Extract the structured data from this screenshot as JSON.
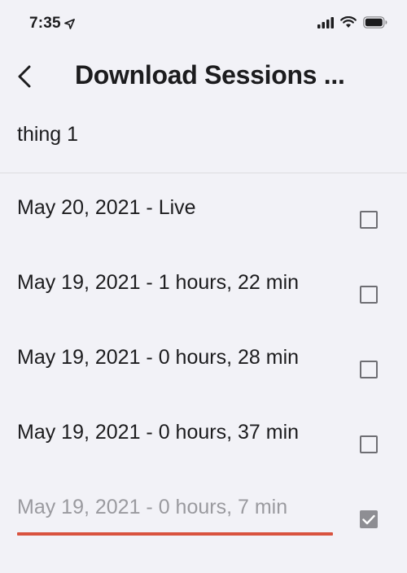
{
  "status_bar": {
    "time": "7:35",
    "location_icon": "location-arrow-icon",
    "signal_icon": "cellular-signal-icon",
    "wifi_icon": "wifi-icon",
    "battery_icon": "battery-icon"
  },
  "nav": {
    "back_icon": "chevron-left-icon",
    "title": "Download Sessions ..."
  },
  "device_name": "thing 1",
  "sessions": [
    {
      "label": "May 20, 2021 - Live",
      "checked": false,
      "disabled": false
    },
    {
      "label": "May 19, 2021 - 1 hours, 22 min",
      "checked": false,
      "disabled": false
    },
    {
      "label": "May 19, 2021 - 0 hours, 28 min",
      "checked": false,
      "disabled": false
    },
    {
      "label": "May 19, 2021 - 0 hours, 37 min",
      "checked": false,
      "disabled": false
    },
    {
      "label": "May 19, 2021 - 0 hours, 7 min",
      "checked": true,
      "disabled": true
    }
  ],
  "colors": {
    "background": "#f2f2f7",
    "accent_underline": "#d9533f",
    "checkbox_border": "#6e6e73",
    "checked_fill": "#8e8e93",
    "disabled_text": "#9a9a9f"
  }
}
